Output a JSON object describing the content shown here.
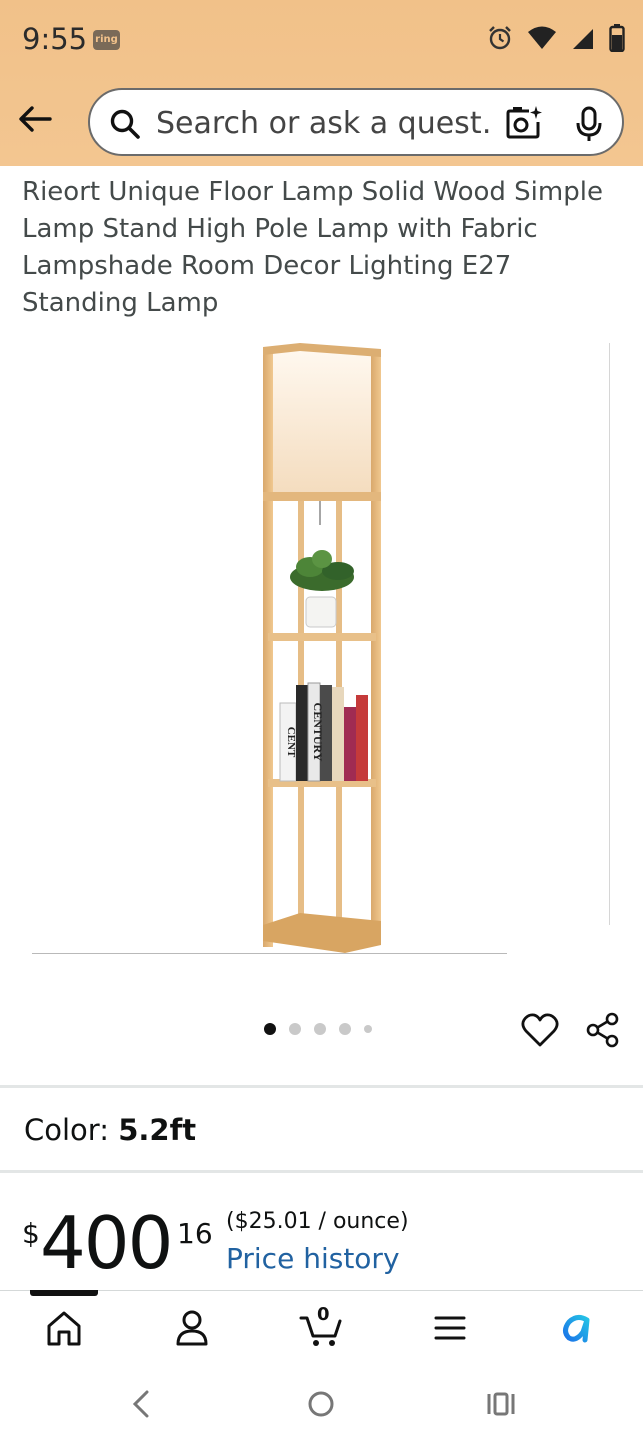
{
  "status_bar": {
    "time": "9:55",
    "notification_badge": "ring",
    "icons": [
      "alarm-icon",
      "wifi-icon",
      "cell-signal-icon",
      "battery-icon"
    ]
  },
  "header": {
    "search_placeholder": "Search or ask a quest…",
    "icons": [
      "back-arrow-icon",
      "search-icon",
      "camera-search-icon",
      "microphone-icon"
    ],
    "background_color": "#f1c189"
  },
  "product": {
    "title": "Rieort Unique Floor Lamp Solid Wood Simple Lamp Stand High Pole Lamp with Fabric Lampshade Room Decor Lighting E27 Standing Lamp",
    "image_book_label_1": "CENTURY",
    "image_book_label_2": "CENT",
    "carousel_dots": 5,
    "carousel_active_index": 0,
    "color_label": "Color:",
    "color_value": "5.2ft",
    "price_currency": "$",
    "price_whole": "400",
    "price_fraction": "16",
    "unit_price": "($25.01 / ounce)",
    "price_history_link": "Price history",
    "link_color": "#2162a1"
  },
  "bottom_nav": {
    "items": [
      "home-icon",
      "account-icon",
      "cart-icon",
      "menu-icon",
      "rufus-icon"
    ],
    "cart_count": "0",
    "active_index": 0
  },
  "system_nav": {
    "items": [
      "back-nav-icon",
      "home-nav-icon",
      "recents-nav-icon"
    ]
  }
}
